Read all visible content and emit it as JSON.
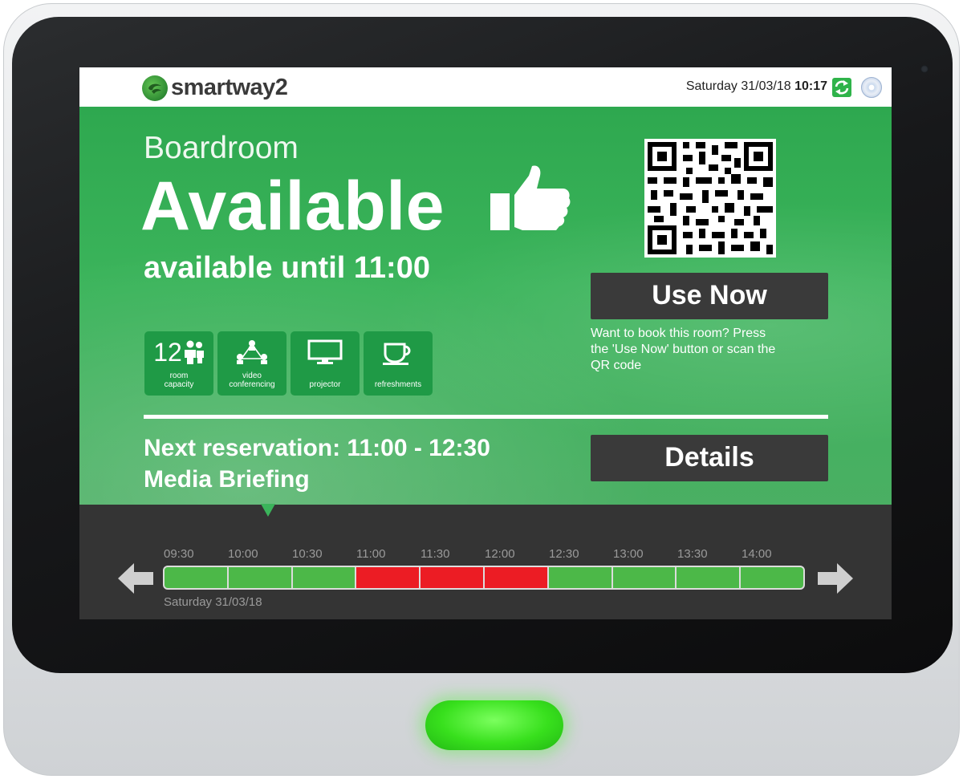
{
  "header": {
    "brand": "smartway2",
    "date": "Saturday 31/03/18",
    "time": "10:17",
    "icons": [
      "refresh-icon",
      "disc-icon"
    ]
  },
  "room": {
    "name": "Boardroom",
    "status": "Available",
    "status_icon": "thumbs-up-icon",
    "until": "available until 11:00"
  },
  "features": [
    {
      "number": "12",
      "icon": "people-icon",
      "label_line1": "room",
      "label_line2": "capacity"
    },
    {
      "number": "",
      "icon": "network-icon",
      "label_line1": "video",
      "label_line2": "conferencing"
    },
    {
      "number": "",
      "icon": "monitor-icon",
      "label_line1": "projector",
      "label_line2": ""
    },
    {
      "number": "",
      "icon": "coffee-cup-icon",
      "label_line1": "refreshments",
      "label_line2": ""
    }
  ],
  "actions": {
    "use_now_label": "Use Now",
    "hint_line1": "Want to book this room? Press",
    "hint_line2": "the 'Use Now' button or scan the",
    "hint_line3": "QR code",
    "details_label": "Details"
  },
  "next_reservation": {
    "line1": "Next reservation: 11:00 - 12:30",
    "line2": "Media Briefing"
  },
  "timeline": {
    "times": [
      "09:30",
      "10:00",
      "10:30",
      "11:00",
      "11:30",
      "12:00",
      "12:30",
      "13:00",
      "13:30",
      "14:00"
    ],
    "slots": [
      "free",
      "free",
      "free",
      "busy",
      "busy",
      "busy",
      "free",
      "free",
      "free",
      "free"
    ],
    "date": "Saturday 31/03/18",
    "free_color": "#4cb848",
    "busy_color": "#ec1c24"
  },
  "colors": {
    "panel_green": "#3bb45b",
    "button_dark": "#3a3a3a",
    "led_green": "#38e01d"
  }
}
